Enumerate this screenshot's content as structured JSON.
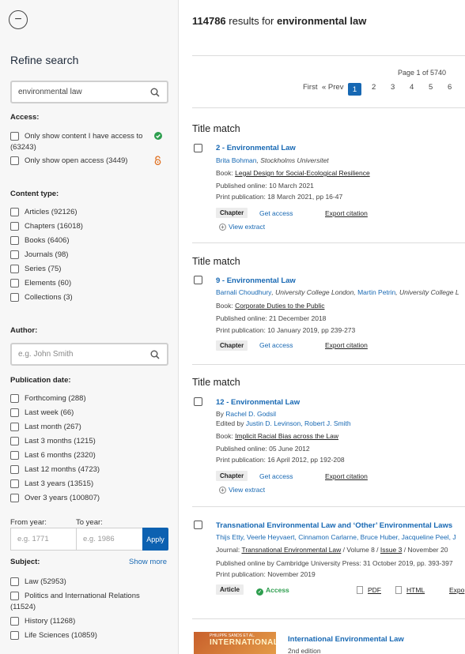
{
  "sidebar": {
    "refine_title": "Refine search",
    "search_value": "environmental law",
    "access": {
      "title": "Access:",
      "only_access_line1": "Only show content I have access to",
      "only_access_line2": "(63243)",
      "open_access": "Only show open access (3449)"
    },
    "content_type": {
      "title": "Content type:",
      "items": [
        "Articles (92126)",
        "Chapters (16018)",
        "Books (6406)",
        "Journals (98)",
        "Series (75)",
        "Elements (60)",
        "Collections (3)"
      ]
    },
    "author": {
      "title": "Author:",
      "placeholder": "e.g. John Smith"
    },
    "publication_date": {
      "title": "Publication date:",
      "items": [
        "Forthcoming (288)",
        "Last week (66)",
        "Last month (267)",
        "Last 3 months (1215)",
        "Last 6 months (2320)",
        "Last 12 months (4723)",
        "Last 3 years (13515)",
        "Over 3 years (100807)"
      ],
      "from_label": "From year:",
      "to_label": "To year:",
      "from_placeholder": "e.g. 1771",
      "to_placeholder": "e.g. 1986",
      "apply": "Apply"
    },
    "subject": {
      "title": "Subject:",
      "show_more": "Show more",
      "law": "Law (52953)",
      "politics_line1": "Politics and International Relations",
      "politics_line2": "(11524)",
      "history": "History (11268)",
      "life_sciences": "Life Sciences (10859)"
    }
  },
  "main": {
    "results_count": "114786",
    "results_for": " results for ",
    "query": "environmental law",
    "page_info": "Page 1 of 5740",
    "pager": {
      "first": "First",
      "prev": "« Prev",
      "pages": [
        "1",
        "2",
        "3",
        "4",
        "5",
        "6"
      ]
    },
    "results": [
      {
        "match": "Title match",
        "title": "2 - Environmental Law",
        "author": "Brita Bohman",
        "affil": ", Stockholms Universitet",
        "book_label": "Book: ",
        "book": "Legal Design for Social-Ecological Resilience",
        "online": "Published online: 10 March 2021",
        "print": "Print publication: 18 March 2021, pp 16-47",
        "tag": "Chapter",
        "get_access": "Get access",
        "export": "Export citation",
        "extract": "View extract"
      },
      {
        "match": "Title match",
        "title": "9 - Environmental Law",
        "author1": "Barnali Choudhury",
        "affil1": ", University College London, ",
        "author2": "Martin Petrin",
        "affil2": ", University College L",
        "book_label": "Book: ",
        "book": "Corporate Duties to the Public",
        "online": "Published online: 21 December 2018",
        "print": "Print publication: 10 January 2019, pp 239-273",
        "tag": "Chapter",
        "get_access": "Get access",
        "export": "Export citation"
      },
      {
        "match": "Title match",
        "title": "12 - Environmental Law",
        "by": "By ",
        "author": "Rachel D. Godsil",
        "edited_by": "Edited by ",
        "editors": "Justin D. Levinson, Robert J. Smith",
        "book_label": "Book: ",
        "book": "Implicit Racial Bias across the Law",
        "online": "Published online: 05 June 2012",
        "print": "Print publication: 16 April 2012, pp 192-208",
        "tag": "Chapter",
        "get_access": "Get access",
        "export": "Export citation",
        "extract": "View extract"
      },
      {
        "title": "Transnational Environmental Law and ‘Other’ Environmental Laws",
        "authors": "Thijs Etty, Veerle Heyvaert, Cinnamon Carlarne, Bruce Huber, Jacqueline Peel, J",
        "journal_label": "Journal: ",
        "journal": "Transnational Environmental Law",
        "volume": " / Volume 8 / ",
        "issue": "Issue 3",
        "issue_date": " / November 20",
        "online": "Published online by Cambridge University Press: 31 October 2019, pp. 393-397",
        "print": "Print publication: November 2019",
        "tag": "Article",
        "access": "Access",
        "pdf": "PDF",
        "html": "HTML",
        "export": "Expo"
      },
      {
        "title": "International Environmental Law",
        "edition": "2nd edition",
        "cover_top": "PHILIPPE SANDS ET AL.",
        "cover_text": "INTERNATIONAL"
      }
    ]
  },
  "colors": {
    "accent": "#1768b3",
    "access_green": "#2e9e4f",
    "open_access_orange": "#e07020"
  }
}
